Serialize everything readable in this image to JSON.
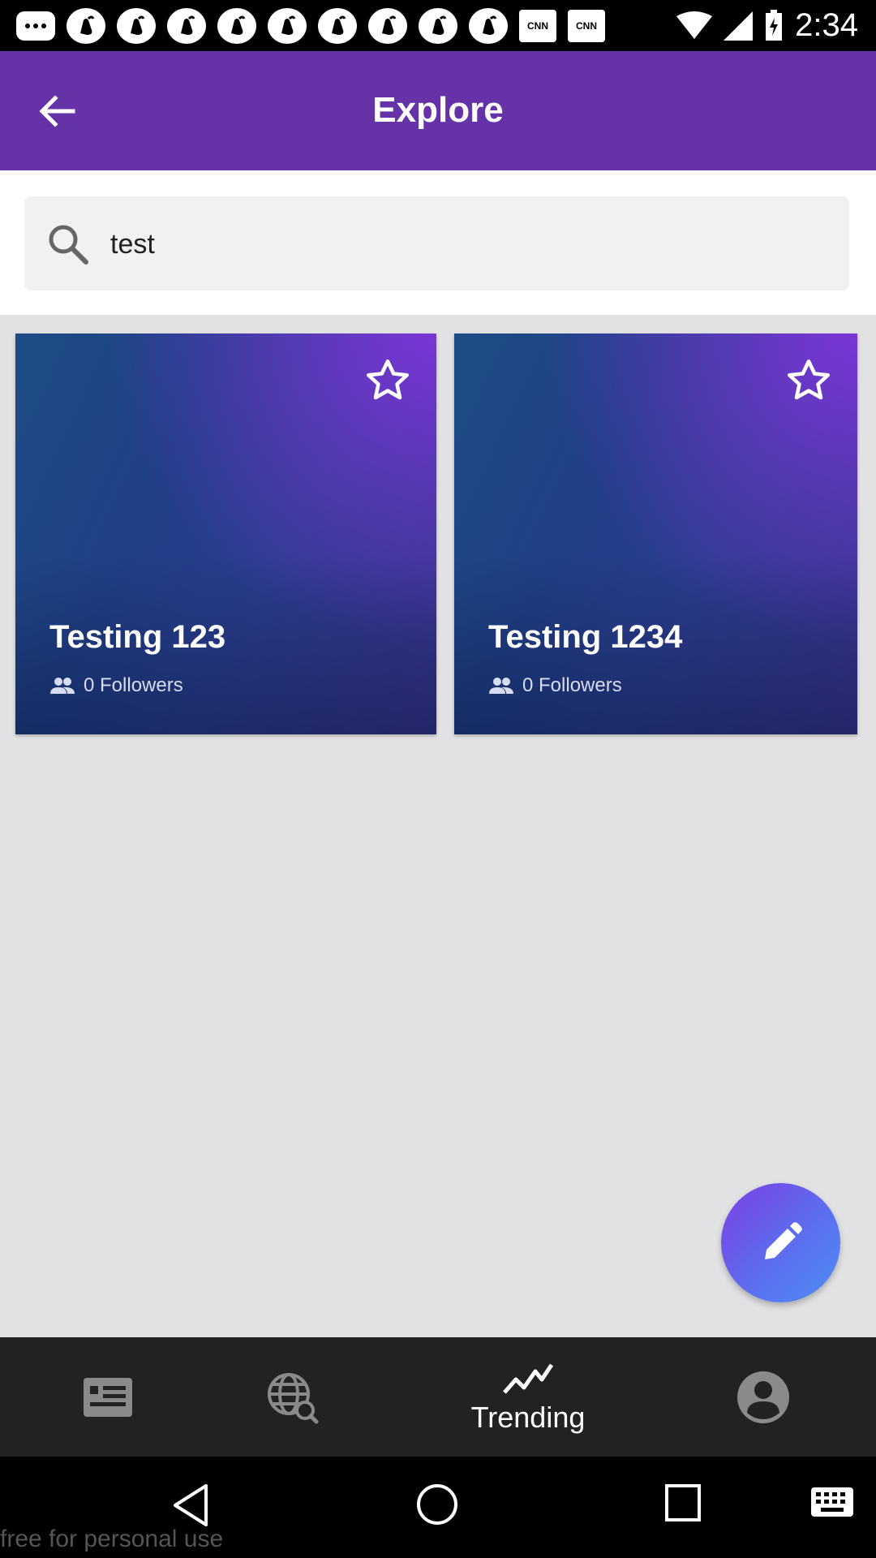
{
  "status_bar": {
    "time": "2:34",
    "notification_icons": [
      "message-icon",
      "hand-icon",
      "hand-icon",
      "hand-icon",
      "hand-icon",
      "hand-icon",
      "hand-icon",
      "hand-icon",
      "hand-icon",
      "hand-icon",
      "cnn-icon",
      "cnn-icon"
    ],
    "cnn_label": "CNN"
  },
  "appbar": {
    "title": "Explore"
  },
  "search": {
    "value": "test",
    "placeholder": ""
  },
  "cards": [
    {
      "title": "Testing 123",
      "followers": "0 Followers"
    },
    {
      "title": "Testing 1234",
      "followers": "0 Followers"
    }
  ],
  "bottom_nav": {
    "items": [
      {
        "icon": "news-icon",
        "label": ""
      },
      {
        "icon": "globe-search-icon",
        "label": ""
      },
      {
        "icon": "trending-icon",
        "label": "Trending"
      },
      {
        "icon": "account-icon",
        "label": ""
      }
    ]
  },
  "watermark": "free for personal use",
  "colors": {
    "primary": "#6533a7",
    "background": "#e2e2e5",
    "bottom_nav": "#222223"
  }
}
